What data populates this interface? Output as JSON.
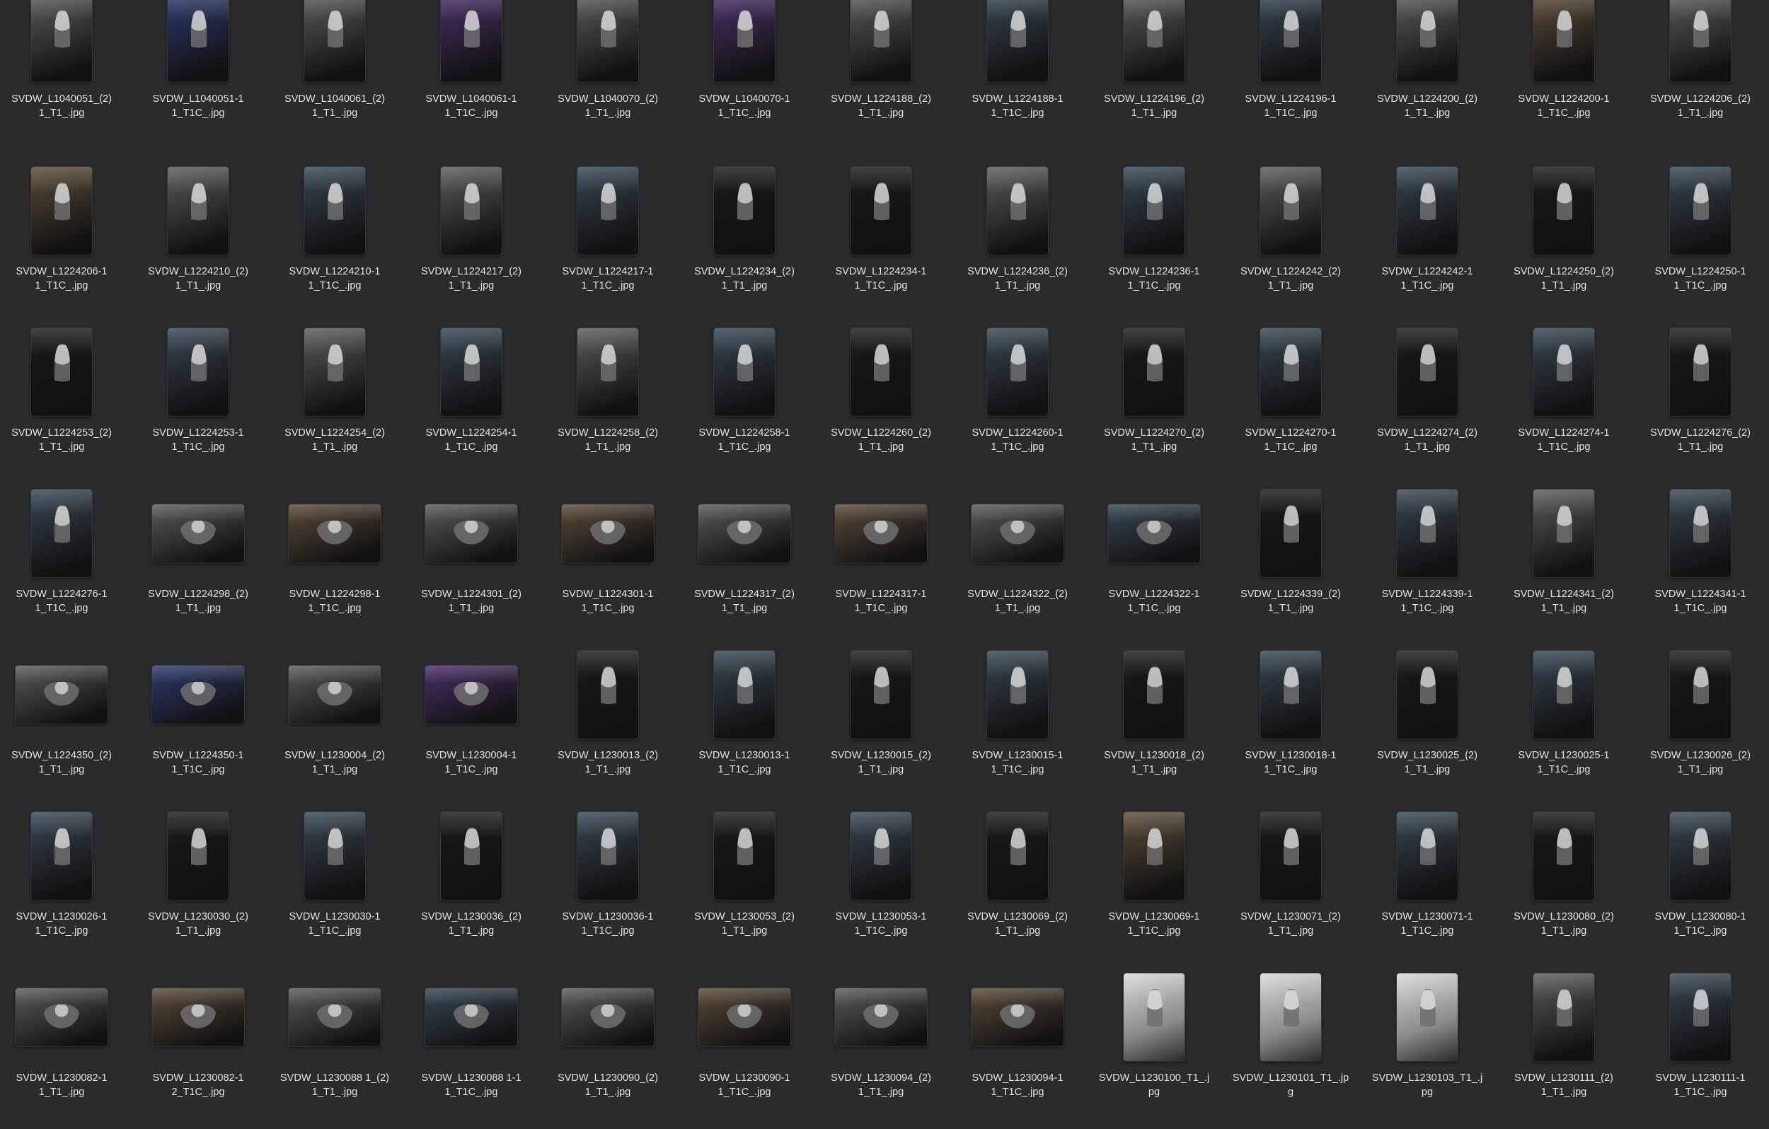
{
  "grid": {
    "items": [
      {
        "line1": "SVDW_L1040051_(2)",
        "line2": "1_T1_.jpg",
        "orientation": "portrait",
        "tone": "bw"
      },
      {
        "line1": "SVDW_L1040051-1",
        "line2": "1_T1C_.jpg",
        "orientation": "portrait",
        "tone": "blue"
      },
      {
        "line1": "SVDW_L1040061_(2)",
        "line2": "1_T1_.jpg",
        "orientation": "portrait",
        "tone": "bw"
      },
      {
        "line1": "SVDW_L1040061-1",
        "line2": "1_T1C_.jpg",
        "orientation": "portrait",
        "tone": "purple"
      },
      {
        "line1": "SVDW_L1040070_(2)",
        "line2": "1_T1_.jpg",
        "orientation": "portrait",
        "tone": "bw"
      },
      {
        "line1": "SVDW_L1040070-1",
        "line2": "1_T1C_.jpg",
        "orientation": "portrait",
        "tone": "purple"
      },
      {
        "line1": "SVDW_L1224188_(2)",
        "line2": "1_T1_.jpg",
        "orientation": "portrait",
        "tone": "bw"
      },
      {
        "line1": "SVDW_L1224188-1",
        "line2": "1_T1C_.jpg",
        "orientation": "portrait",
        "tone": "color"
      },
      {
        "line1": "SVDW_L1224196_(2)",
        "line2": "1_T1_.jpg",
        "orientation": "portrait",
        "tone": "bw"
      },
      {
        "line1": "SVDW_L1224196-1",
        "line2": "1_T1C_.jpg",
        "orientation": "portrait",
        "tone": "color"
      },
      {
        "line1": "SVDW_L1224200_(2)",
        "line2": "1_T1_.jpg",
        "orientation": "portrait",
        "tone": "bw"
      },
      {
        "line1": "SVDW_L1224200-1",
        "line2": "1_T1C_.jpg",
        "orientation": "portrait",
        "tone": "warm"
      },
      {
        "line1": "SVDW_L1224206_(2)",
        "line2": "1_T1_.jpg",
        "orientation": "portrait",
        "tone": "bw"
      },
      {
        "line1": "SVDW_L1224206-1",
        "line2": "1_T1C_.jpg",
        "orientation": "portrait",
        "tone": "warm"
      },
      {
        "line1": "SVDW_L1224210_(2)",
        "line2": "1_T1_.jpg",
        "orientation": "portrait",
        "tone": "bw"
      },
      {
        "line1": "SVDW_L1224210-1",
        "line2": "1_T1C_.jpg",
        "orientation": "portrait",
        "tone": "color"
      },
      {
        "line1": "SVDW_L1224217_(2)",
        "line2": "1_T1_.jpg",
        "orientation": "portrait",
        "tone": "bw"
      },
      {
        "line1": "SVDW_L1224217-1",
        "line2": "1_T1C_.jpg",
        "orientation": "portrait",
        "tone": "color"
      },
      {
        "line1": "SVDW_L1224234_(2)",
        "line2": "1_T1_.jpg",
        "orientation": "portrait",
        "tone": "dark"
      },
      {
        "line1": "SVDW_L1224234-1",
        "line2": "1_T1C_.jpg",
        "orientation": "portrait",
        "tone": "dark"
      },
      {
        "line1": "SVDW_L1224236_(2)",
        "line2": "1_T1_.jpg",
        "orientation": "portrait",
        "tone": "bw"
      },
      {
        "line1": "SVDW_L1224236-1",
        "line2": "1_T1C_.jpg",
        "orientation": "portrait",
        "tone": "color"
      },
      {
        "line1": "SVDW_L1224242_(2)",
        "line2": "1_T1_.jpg",
        "orientation": "portrait",
        "tone": "bw"
      },
      {
        "line1": "SVDW_L1224242-1",
        "line2": "1_T1C_.jpg",
        "orientation": "portrait",
        "tone": "color"
      },
      {
        "line1": "SVDW_L1224250_(2)",
        "line2": "1_T1_.jpg",
        "orientation": "portrait",
        "tone": "dark"
      },
      {
        "line1": "SVDW_L1224250-1",
        "line2": "1_T1C_.jpg",
        "orientation": "portrait",
        "tone": "color"
      },
      {
        "line1": "SVDW_L1224253_(2)",
        "line2": "1_T1_.jpg",
        "orientation": "portrait",
        "tone": "dark"
      },
      {
        "line1": "SVDW_L1224253-1",
        "line2": "1_T1C_.jpg",
        "orientation": "portrait",
        "tone": "color"
      },
      {
        "line1": "SVDW_L1224254_(2)",
        "line2": "1_T1_.jpg",
        "orientation": "portrait",
        "tone": "bw"
      },
      {
        "line1": "SVDW_L1224254-1",
        "line2": "1_T1C_.jpg",
        "orientation": "portrait",
        "tone": "color"
      },
      {
        "line1": "SVDW_L1224258_(2)",
        "line2": "1_T1_.jpg",
        "orientation": "portrait",
        "tone": "bw"
      },
      {
        "line1": "SVDW_L1224258-1",
        "line2": "1_T1C_.jpg",
        "orientation": "portrait",
        "tone": "color"
      },
      {
        "line1": "SVDW_L1224260_(2)",
        "line2": "1_T1_.jpg",
        "orientation": "portrait",
        "tone": "dark"
      },
      {
        "line1": "SVDW_L1224260-1",
        "line2": "1_T1C_.jpg",
        "orientation": "portrait",
        "tone": "color"
      },
      {
        "line1": "SVDW_L1224270_(2)",
        "line2": "1_T1_.jpg",
        "orientation": "portrait",
        "tone": "dark"
      },
      {
        "line1": "SVDW_L1224270-1",
        "line2": "1_T1C_.jpg",
        "orientation": "portrait",
        "tone": "color"
      },
      {
        "line1": "SVDW_L1224274_(2)",
        "line2": "1_T1_.jpg",
        "orientation": "portrait",
        "tone": "dark"
      },
      {
        "line1": "SVDW_L1224274-1",
        "line2": "1_T1C_.jpg",
        "orientation": "portrait",
        "tone": "color"
      },
      {
        "line1": "SVDW_L1224276_(2)",
        "line2": "1_T1_.jpg",
        "orientation": "portrait",
        "tone": "dark"
      },
      {
        "line1": "SVDW_L1224276-1",
        "line2": "1_T1C_.jpg",
        "orientation": "portrait",
        "tone": "color"
      },
      {
        "line1": "SVDW_L1224298_(2)",
        "line2": "1_T1_.jpg",
        "orientation": "landscape",
        "tone": "bw"
      },
      {
        "line1": "SVDW_L1224298-1",
        "line2": "1_T1C_.jpg",
        "orientation": "landscape",
        "tone": "warm"
      },
      {
        "line1": "SVDW_L1224301_(2)",
        "line2": "1_T1_.jpg",
        "orientation": "landscape",
        "tone": "bw"
      },
      {
        "line1": "SVDW_L1224301-1",
        "line2": "1_T1C_.jpg",
        "orientation": "landscape",
        "tone": "warm"
      },
      {
        "line1": "SVDW_L1224317_(2)",
        "line2": "1_T1_.jpg",
        "orientation": "landscape",
        "tone": "bw"
      },
      {
        "line1": "SVDW_L1224317-1",
        "line2": "1_T1C_.jpg",
        "orientation": "landscape",
        "tone": "warm"
      },
      {
        "line1": "SVDW_L1224322_(2)",
        "line2": "1_T1_.jpg",
        "orientation": "landscape",
        "tone": "bw"
      },
      {
        "line1": "SVDW_L1224322-1",
        "line2": "1_T1C_.jpg",
        "orientation": "landscape",
        "tone": "color"
      },
      {
        "line1": "SVDW_L1224339_(2)",
        "line2": "1_T1_.jpg",
        "orientation": "portrait",
        "tone": "dark"
      },
      {
        "line1": "SVDW_L1224339-1",
        "line2": "1_T1C_.jpg",
        "orientation": "portrait",
        "tone": "color"
      },
      {
        "line1": "SVDW_L1224341_(2)",
        "line2": "1_T1_.jpg",
        "orientation": "portrait",
        "tone": "bw"
      },
      {
        "line1": "SVDW_L1224341-1",
        "line2": "1_T1C_.jpg",
        "orientation": "portrait",
        "tone": "color"
      },
      {
        "line1": "SVDW_L1224350_(2)",
        "line2": "1_T1_.jpg",
        "orientation": "landscape",
        "tone": "bw"
      },
      {
        "line1": "SVDW_L1224350-1",
        "line2": "1_T1C_.jpg",
        "orientation": "landscape",
        "tone": "blue"
      },
      {
        "line1": "SVDW_L1230004_(2)",
        "line2": "1_T1_.jpg",
        "orientation": "landscape",
        "tone": "bw"
      },
      {
        "line1": "SVDW_L1230004-1",
        "line2": "1_T1C_.jpg",
        "orientation": "landscape",
        "tone": "purple"
      },
      {
        "line1": "SVDW_L1230013_(2)",
        "line2": "1_T1_.jpg",
        "orientation": "portrait",
        "tone": "dark"
      },
      {
        "line1": "SVDW_L1230013-1",
        "line2": "1_T1C_.jpg",
        "orientation": "portrait",
        "tone": "color"
      },
      {
        "line1": "SVDW_L1230015_(2)",
        "line2": "1_T1_.jpg",
        "orientation": "portrait",
        "tone": "dark"
      },
      {
        "line1": "SVDW_L1230015-1",
        "line2": "1_T1C_.jpg",
        "orientation": "portrait",
        "tone": "color"
      },
      {
        "line1": "SVDW_L1230018_(2)",
        "line2": "1_T1_.jpg",
        "orientation": "portrait",
        "tone": "dark"
      },
      {
        "line1": "SVDW_L1230018-1",
        "line2": "1_T1C_.jpg",
        "orientation": "portrait",
        "tone": "color"
      },
      {
        "line1": "SVDW_L1230025_(2)",
        "line2": "1_T1_.jpg",
        "orientation": "portrait",
        "tone": "dark"
      },
      {
        "line1": "SVDW_L1230025-1",
        "line2": "1_T1C_.jpg",
        "orientation": "portrait",
        "tone": "color"
      },
      {
        "line1": "SVDW_L1230026_(2)",
        "line2": "1_T1_.jpg",
        "orientation": "portrait",
        "tone": "dark"
      },
      {
        "line1": "SVDW_L1230026-1",
        "line2": "1_T1C_.jpg",
        "orientation": "portrait",
        "tone": "color"
      },
      {
        "line1": "SVDW_L1230030_(2)",
        "line2": "1_T1_.jpg",
        "orientation": "portrait",
        "tone": "dark"
      },
      {
        "line1": "SVDW_L1230030-1",
        "line2": "1_T1C_.jpg",
        "orientation": "portrait",
        "tone": "color"
      },
      {
        "line1": "SVDW_L1230036_(2)",
        "line2": "1_T1_.jpg",
        "orientation": "portrait",
        "tone": "dark"
      },
      {
        "line1": "SVDW_L1230036-1",
        "line2": "1_T1C_.jpg",
        "orientation": "portrait",
        "tone": "color"
      },
      {
        "line1": "SVDW_L1230053_(2)",
        "line2": "1_T1_.jpg",
        "orientation": "portrait",
        "tone": "dark"
      },
      {
        "line1": "SVDW_L1230053-1",
        "line2": "1_T1C_.jpg",
        "orientation": "portrait",
        "tone": "color"
      },
      {
        "line1": "SVDW_L1230069_(2)",
        "line2": "1_T1_.jpg",
        "orientation": "portrait",
        "tone": "dark"
      },
      {
        "line1": "SVDW_L1230069-1",
        "line2": "1_T1C_.jpg",
        "orientation": "portrait",
        "tone": "warm"
      },
      {
        "line1": "SVDW_L1230071_(2)",
        "line2": "1_T1_.jpg",
        "orientation": "portrait",
        "tone": "dark"
      },
      {
        "line1": "SVDW_L1230071-1",
        "line2": "1_T1C_.jpg",
        "orientation": "portrait",
        "tone": "color"
      },
      {
        "line1": "SVDW_L1230080_(2)",
        "line2": "1_T1_.jpg",
        "orientation": "portrait",
        "tone": "dark"
      },
      {
        "line1": "SVDW_L1230080-1",
        "line2": "1_T1C_.jpg",
        "orientation": "portrait",
        "tone": "color"
      },
      {
        "line1": "SVDW_L1230082-1",
        "line2": "1_T1_.jpg",
        "orientation": "landscape",
        "tone": "bw"
      },
      {
        "line1": "SVDW_L1230082-1",
        "line2": "2_T1C_.jpg",
        "orientation": "landscape",
        "tone": "warm"
      },
      {
        "line1": "SVDW_L1230088 1_(2)",
        "line2": "1_T1_.jpg",
        "orientation": "landscape",
        "tone": "bw"
      },
      {
        "line1": "SVDW_L1230088 1-1",
        "line2": "1_T1C_.jpg",
        "orientation": "landscape",
        "tone": "color"
      },
      {
        "line1": "SVDW_L1230090_(2)",
        "line2": "1_T1_.jpg",
        "orientation": "landscape",
        "tone": "bw"
      },
      {
        "line1": "SVDW_L1230090-1",
        "line2": "1_T1C_.jpg",
        "orientation": "landscape",
        "tone": "warm"
      },
      {
        "line1": "SVDW_L1230094_(2)",
        "line2": "1_T1_.jpg",
        "orientation": "landscape",
        "tone": "bw"
      },
      {
        "line1": "SVDW_L1230094-1",
        "line2": "1_T1C_.jpg",
        "orientation": "landscape",
        "tone": "warm"
      },
      {
        "line1": "SVDW_L1230100_T1_.j",
        "line2": "pg",
        "orientation": "portrait",
        "tone": "light"
      },
      {
        "line1": "SVDW_L1230101_T1_.jp",
        "line2": "g",
        "orientation": "portrait",
        "tone": "light"
      },
      {
        "line1": "SVDW_L1230103_T1_.j",
        "line2": "pg",
        "orientation": "portrait",
        "tone": "light"
      },
      {
        "line1": "SVDW_L1230111_(2)",
        "line2": "1_T1_.jpg",
        "orientation": "portrait",
        "tone": "bw"
      },
      {
        "line1": "SVDW_L1230111-1",
        "line2": "1_T1C_.jpg",
        "orientation": "portrait",
        "tone": "color"
      }
    ]
  },
  "tones": {
    "bw": "#5a5a5c",
    "blue": "#2d3a6e",
    "purple": "#4a2f6a",
    "color": "#354552",
    "warm": "#5a4a38",
    "dark": "#1a1a1c",
    "light": "#b8b8b8"
  },
  "colors": {
    "background": "#2b2b2d",
    "caption_text": "#e2e2e2"
  }
}
